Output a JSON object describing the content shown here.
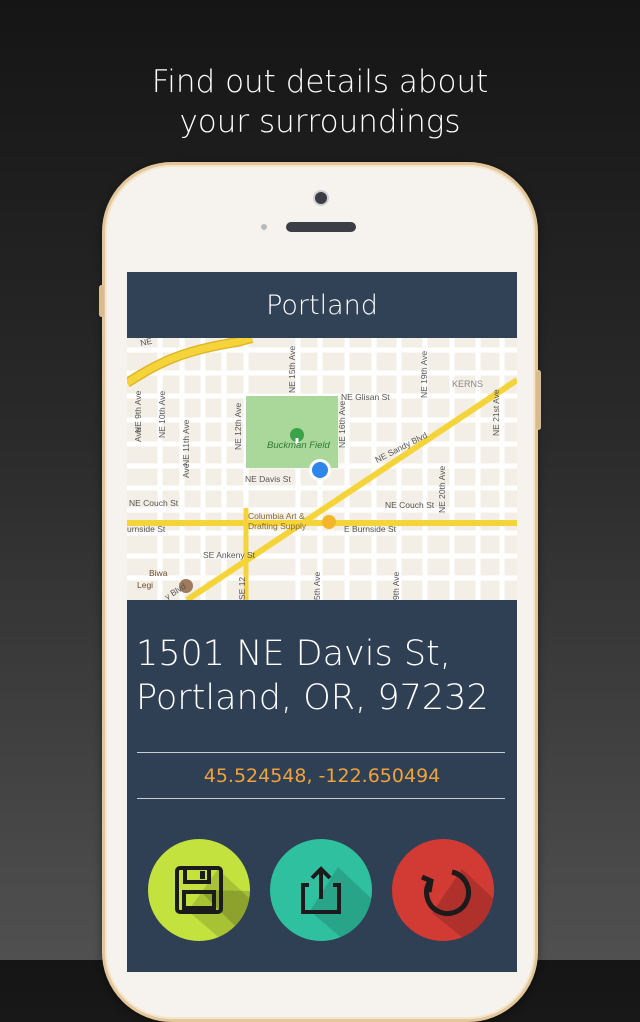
{
  "promo": {
    "line1": "Find out details about",
    "line2": "your surroundings"
  },
  "app": {
    "title": "Portland"
  },
  "map": {
    "labels": {
      "ne_glisan": "NE Glisan St",
      "kerns": "KERNS",
      "buckman_field": "Buckman Field",
      "ne_sandy": "NE Sandy Blvd",
      "ne_davis": "NE Davis St",
      "ne_couch_w": "NE Couch St",
      "ne_couch_e": "NE Couch St",
      "burnside_w": "urnside St",
      "e_burnside": "E Burnside St",
      "columbia1": "Columbia Art &",
      "columbia2": "Drafting Supply",
      "se_ankeny": "SE Ankeny St",
      "biwa": "Biwa",
      "legin": "Legi",
      "sandy_blvd_sw": "y Blvd",
      "ne_9th": "NE 9th Ave",
      "ne_10th": "NE 10th Ave",
      "ne_11th": "NE 11th Ave",
      "ne_12th": "NE 12th Ave",
      "ne_15th": "NE 15th Ave",
      "ne_16th": "NE 16th Ave",
      "ne_19th": "NE 19th Ave",
      "ne_20th": "NE 20th Ave",
      "ne_21st": "NE 21st Ave",
      "se_12": "SE 12",
      "ave_a": "Ave",
      "ave_b": "Ave",
      "fifteenth": "5th Ave",
      "nineteenth_s": "9th Ave",
      "ne_top": "NE"
    },
    "colors": {
      "background": "#f3efe6",
      "street": "#ffffff",
      "highway": "#f5d43a",
      "park": "#a9d89a",
      "location": "#2f86ea"
    }
  },
  "location": {
    "address_line1": "1501 NE Davis St,",
    "address_line2": "Portland, OR, 97232",
    "coordinates": "45.524548, -122.650494"
  },
  "actions": {
    "save_color": "#c3e23e",
    "share_color": "#2fc0a0",
    "refresh_color": "#d23a34"
  }
}
